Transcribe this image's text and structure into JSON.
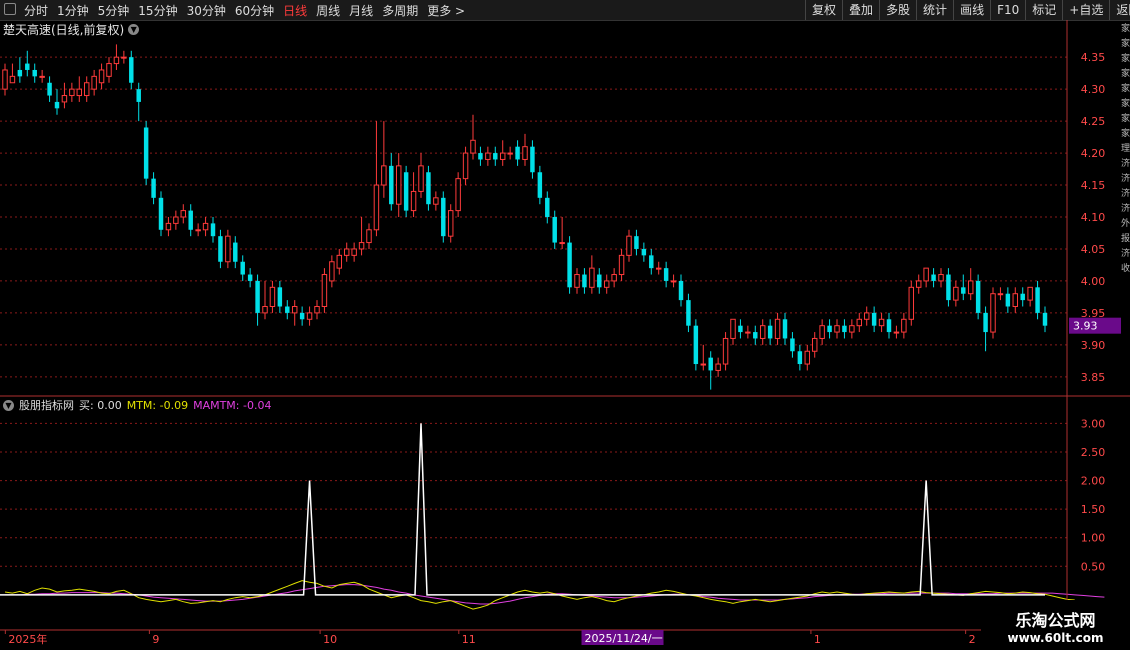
{
  "toolbar": {
    "periods": [
      "分时",
      "1分钟",
      "5分钟",
      "15分钟",
      "30分钟",
      "60分钟",
      "日线",
      "周线",
      "月线",
      "多周期",
      "更多 >"
    ],
    "active": "日线",
    "right_buttons": [
      "复权",
      "叠加",
      "多股",
      "统计",
      "画线",
      "F10",
      "标记",
      "+自选",
      "返回"
    ]
  },
  "chart": {
    "title": "楚天高速(日线,前复权)",
    "price_axis": [
      "4.35",
      "4.30",
      "4.25",
      "4.20",
      "4.15",
      "4.10",
      "4.05",
      "4.00",
      "3.95",
      "3.90",
      "3.85"
    ],
    "current_price": "3.93",
    "indicator_name": "股朋指标网",
    "ind_buy": "买: 0.00",
    "ind_mtm": "MTM: -0.09",
    "ind_mamtm": "MAMTM: -0.04",
    "ind_axis": [
      "3.00",
      "2.50",
      "2.00",
      "1.50",
      "1.00",
      "0.50"
    ],
    "date_labels": [
      "2025年",
      "9",
      "10",
      "11",
      "2025/11/24/一",
      "1",
      "2"
    ]
  },
  "right_strip": [
    "家",
    "家",
    "家",
    "家",
    "家",
    "家",
    "家",
    "家",
    "理",
    "济",
    "济",
    "济",
    "济",
    "外",
    "报",
    "济",
    "收"
  ],
  "watermark": {
    "line1": "乐淘公式网",
    "line2": "www.60lt.com"
  },
  "colors": {
    "up": "#ff3b3b",
    "down": "#00e0e8",
    "mtm": "#e0e000",
    "mamtm": "#e040e0",
    "buy": "#ffffff",
    "grid": "#8a1a1a",
    "axis": "#b03030",
    "highlight": "#6a0a8a"
  },
  "chart_data": {
    "type": "candlestick",
    "ylim": [
      3.82,
      4.38
    ],
    "candles": [
      [
        4.3,
        4.33,
        4.29,
        4.34
      ],
      [
        4.31,
        4.32,
        4.31,
        4.34
      ],
      [
        4.33,
        4.32,
        4.31,
        4.35
      ],
      [
        4.34,
        4.33,
        4.32,
        4.36
      ],
      [
        4.33,
        4.32,
        4.31,
        4.34
      ],
      [
        4.32,
        4.32,
        4.31,
        4.33
      ],
      [
        4.31,
        4.29,
        4.28,
        4.32
      ],
      [
        4.28,
        4.27,
        4.26,
        4.3
      ],
      [
        4.28,
        4.29,
        4.27,
        4.31
      ],
      [
        4.29,
        4.3,
        4.28,
        4.31
      ],
      [
        4.29,
        4.3,
        4.28,
        4.32
      ],
      [
        4.29,
        4.31,
        4.28,
        4.32
      ],
      [
        4.3,
        4.32,
        4.29,
        4.33
      ],
      [
        4.31,
        4.33,
        4.3,
        4.34
      ],
      [
        4.32,
        4.34,
        4.31,
        4.35
      ],
      [
        4.34,
        4.35,
        4.33,
        4.37
      ],
      [
        4.35,
        4.35,
        4.34,
        4.36
      ],
      [
        4.35,
        4.31,
        4.3,
        4.36
      ],
      [
        4.3,
        4.28,
        4.25,
        4.31
      ],
      [
        4.24,
        4.16,
        4.15,
        4.25
      ],
      [
        4.16,
        4.13,
        4.12,
        4.17
      ],
      [
        4.13,
        4.08,
        4.07,
        4.14
      ],
      [
        4.08,
        4.09,
        4.07,
        4.1
      ],
      [
        4.09,
        4.1,
        4.08,
        4.11
      ],
      [
        4.1,
        4.11,
        4.09,
        4.12
      ],
      [
        4.11,
        4.08,
        4.07,
        4.12
      ],
      [
        4.08,
        4.08,
        4.07,
        4.09
      ],
      [
        4.08,
        4.09,
        4.07,
        4.1
      ],
      [
        4.09,
        4.07,
        4.06,
        4.1
      ],
      [
        4.07,
        4.03,
        4.02,
        4.08
      ],
      [
        4.03,
        4.07,
        4.02,
        4.08
      ],
      [
        4.06,
        4.03,
        4.02,
        4.07
      ],
      [
        4.03,
        4.01,
        4.0,
        4.04
      ],
      [
        4.01,
        4.0,
        3.99,
        4.02
      ],
      [
        4.0,
        3.95,
        3.93,
        4.01
      ],
      [
        3.95,
        3.96,
        3.94,
        4.0
      ],
      [
        3.96,
        3.99,
        3.95,
        4.0
      ],
      [
        3.99,
        3.96,
        3.95,
        4.0
      ],
      [
        3.96,
        3.95,
        3.94,
        3.97
      ],
      [
        3.95,
        3.96,
        3.93,
        3.97
      ],
      [
        3.95,
        3.94,
        3.93,
        3.96
      ],
      [
        3.94,
        3.95,
        3.93,
        3.96
      ],
      [
        3.95,
        3.96,
        3.94,
        3.97
      ],
      [
        3.96,
        4.01,
        3.95,
        4.02
      ],
      [
        4.0,
        4.03,
        3.99,
        4.04
      ],
      [
        4.02,
        4.04,
        4.01,
        4.05
      ],
      [
        4.04,
        4.05,
        4.03,
        4.06
      ],
      [
        4.04,
        4.05,
        4.03,
        4.06
      ],
      [
        4.05,
        4.06,
        4.04,
        4.1
      ],
      [
        4.06,
        4.08,
        4.05,
        4.09
      ],
      [
        4.08,
        4.15,
        4.07,
        4.25
      ],
      [
        4.15,
        4.18,
        4.13,
        4.25
      ],
      [
        4.18,
        4.12,
        4.11,
        4.2
      ],
      [
        4.12,
        4.18,
        4.1,
        4.2
      ],
      [
        4.17,
        4.11,
        4.1,
        4.18
      ],
      [
        4.11,
        4.14,
        4.1,
        4.17
      ],
      [
        4.14,
        4.18,
        4.13,
        4.2
      ],
      [
        4.17,
        4.12,
        4.11,
        4.18
      ],
      [
        4.12,
        4.13,
        4.11,
        4.14
      ],
      [
        4.13,
        4.07,
        4.06,
        4.14
      ],
      [
        4.07,
        4.11,
        4.06,
        4.12
      ],
      [
        4.11,
        4.16,
        4.1,
        4.17
      ],
      [
        4.16,
        4.2,
        4.15,
        4.21
      ],
      [
        4.2,
        4.22,
        4.19,
        4.26
      ],
      [
        4.2,
        4.19,
        4.18,
        4.21
      ],
      [
        4.19,
        4.2,
        4.18,
        4.21
      ],
      [
        4.2,
        4.19,
        4.18,
        4.21
      ],
      [
        4.19,
        4.2,
        4.18,
        4.22
      ],
      [
        4.2,
        4.2,
        4.19,
        4.21
      ],
      [
        4.21,
        4.19,
        4.18,
        4.22
      ],
      [
        4.19,
        4.21,
        4.18,
        4.23
      ],
      [
        4.21,
        4.17,
        4.16,
        4.22
      ],
      [
        4.17,
        4.13,
        4.12,
        4.18
      ],
      [
        4.13,
        4.1,
        4.09,
        4.14
      ],
      [
        4.1,
        4.06,
        4.05,
        4.11
      ],
      [
        4.06,
        4.06,
        4.05,
        4.1
      ],
      [
        4.06,
        3.99,
        3.98,
        4.07
      ],
      [
        3.99,
        4.01,
        3.98,
        4.02
      ],
      [
        4.01,
        3.99,
        3.98,
        4.02
      ],
      [
        3.99,
        4.02,
        3.98,
        4.04
      ],
      [
        4.01,
        3.99,
        3.98,
        4.02
      ],
      [
        3.99,
        4.0,
        3.98,
        4.01
      ],
      [
        4.0,
        4.01,
        3.99,
        4.02
      ],
      [
        4.01,
        4.04,
        4.0,
        4.05
      ],
      [
        4.04,
        4.07,
        4.03,
        4.08
      ],
      [
        4.07,
        4.05,
        4.04,
        4.08
      ],
      [
        4.05,
        4.04,
        4.03,
        4.06
      ],
      [
        4.04,
        4.02,
        4.01,
        4.05
      ],
      [
        4.02,
        4.02,
        4.01,
        4.03
      ],
      [
        4.02,
        4.0,
        3.99,
        4.03
      ],
      [
        4.0,
        4.0,
        3.99,
        4.01
      ],
      [
        4.0,
        3.97,
        3.96,
        4.01
      ],
      [
        3.97,
        3.93,
        3.92,
        3.98
      ],
      [
        3.93,
        3.87,
        3.86,
        3.94
      ],
      [
        3.87,
        3.87,
        3.86,
        3.9
      ],
      [
        3.88,
        3.86,
        3.83,
        3.89
      ],
      [
        3.86,
        3.87,
        3.85,
        3.88
      ],
      [
        3.87,
        3.91,
        3.86,
        3.92
      ],
      [
        3.91,
        3.94,
        3.9,
        3.94
      ],
      [
        3.93,
        3.92,
        3.91,
        3.94
      ],
      [
        3.92,
        3.92,
        3.91,
        3.93
      ],
      [
        3.92,
        3.91,
        3.9,
        3.93
      ],
      [
        3.91,
        3.93,
        3.9,
        3.94
      ],
      [
        3.93,
        3.91,
        3.9,
        3.94
      ],
      [
        3.91,
        3.94,
        3.9,
        3.95
      ],
      [
        3.94,
        3.91,
        3.9,
        3.95
      ],
      [
        3.91,
        3.89,
        3.88,
        3.92
      ],
      [
        3.89,
        3.87,
        3.86,
        3.9
      ],
      [
        3.87,
        3.89,
        3.86,
        3.9
      ],
      [
        3.89,
        3.91,
        3.88,
        3.92
      ],
      [
        3.91,
        3.93,
        3.9,
        3.94
      ],
      [
        3.93,
        3.92,
        3.91,
        3.94
      ],
      [
        3.92,
        3.93,
        3.91,
        3.94
      ],
      [
        3.93,
        3.92,
        3.91,
        3.94
      ],
      [
        3.92,
        3.93,
        3.91,
        3.94
      ],
      [
        3.93,
        3.94,
        3.92,
        3.95
      ],
      [
        3.94,
        3.95,
        3.93,
        3.96
      ],
      [
        3.95,
        3.93,
        3.92,
        3.96
      ],
      [
        3.93,
        3.94,
        3.92,
        3.95
      ],
      [
        3.94,
        3.92,
        3.91,
        3.95
      ],
      [
        3.92,
        3.92,
        3.91,
        3.93
      ],
      [
        3.92,
        3.94,
        3.91,
        3.95
      ],
      [
        3.94,
        3.99,
        3.93,
        4.0
      ],
      [
        3.99,
        4.0,
        3.98,
        4.01
      ],
      [
        4.0,
        4.02,
        3.99,
        4.02
      ],
      [
        4.01,
        4.0,
        3.99,
        4.02
      ],
      [
        4.0,
        4.01,
        3.99,
        4.02
      ],
      [
        4.01,
        3.97,
        3.96,
        4.02
      ],
      [
        3.97,
        3.99,
        3.96,
        4.0
      ],
      [
        3.99,
        3.98,
        3.97,
        4.01
      ],
      [
        3.98,
        4.0,
        3.97,
        4.02
      ],
      [
        4.0,
        3.95,
        3.94,
        4.01
      ],
      [
        3.95,
        3.92,
        3.89,
        3.96
      ],
      [
        3.92,
        3.98,
        3.91,
        3.99
      ],
      [
        3.98,
        3.98,
        3.97,
        3.99
      ],
      [
        3.98,
        3.96,
        3.95,
        3.99
      ],
      [
        3.96,
        3.98,
        3.95,
        3.99
      ],
      [
        3.98,
        3.97,
        3.96,
        3.99
      ],
      [
        3.97,
        3.99,
        3.96,
        3.99
      ],
      [
        3.99,
        3.95,
        3.94,
        4.0
      ],
      [
        3.95,
        3.93,
        3.92,
        3.96
      ]
    ],
    "buy_signals": [
      {
        "index": 41,
        "value": 2.0
      },
      {
        "index": 56,
        "value": 3.0
      },
      {
        "index": 124,
        "value": 2.0
      }
    ],
    "mtm": [
      0.05,
      0.03,
      0.06,
      0.02,
      0.08,
      0.12,
      0.1,
      0.05,
      0.07,
      0.08,
      0.1,
      0.08,
      0.06,
      0.03,
      0.02,
      0.06,
      0.08,
      0.02,
      -0.05,
      -0.08,
      -0.1,
      -0.12,
      -0.1,
      -0.08,
      -0.12,
      -0.15,
      -0.14,
      -0.12,
      -0.1,
      -0.12,
      -0.08,
      -0.05,
      -0.03,
      -0.05,
      -0.03,
      0.0,
      0.05,
      0.1,
      0.15,
      0.2,
      0.25,
      0.22,
      0.2,
      0.15,
      0.12,
      0.18,
      0.2,
      0.22,
      0.18,
      0.1,
      0.05,
      0.0,
      -0.05,
      -0.02,
      0.0,
      -0.05,
      -0.1,
      -0.12,
      -0.15,
      -0.12,
      -0.1,
      -0.15,
      -0.2,
      -0.25,
      -0.22,
      -0.18,
      -0.1,
      -0.05,
      0.0,
      0.05,
      0.08,
      0.05,
      0.03,
      0.05,
      0.02,
      -0.02,
      -0.05,
      -0.08,
      -0.05,
      -0.03,
      -0.06,
      -0.1,
      -0.12,
      -0.08,
      -0.05,
      -0.02,
      0.0,
      0.03,
      0.05,
      0.08,
      0.06,
      0.03,
      0.0,
      -0.02,
      -0.05,
      -0.08,
      -0.1,
      -0.12,
      -0.15,
      -0.12,
      -0.1,
      -0.08,
      -0.1,
      -0.12,
      -0.1,
      -0.08,
      -0.06,
      -0.04,
      -0.02,
      0.02,
      0.05,
      0.03,
      0.05,
      0.03,
      0.01,
      0.0,
      0.02,
      0.03,
      0.04,
      0.05,
      0.04,
      0.03,
      0.05,
      0.06,
      0.04,
      0.03,
      0.02,
      0.01,
      0.0,
      -0.01,
      0.02,
      0.04,
      0.06,
      0.05,
      0.04,
      0.02,
      0.03,
      0.05,
      0.04,
      0.02,
      0.01,
      -0.02,
      -0.05,
      -0.08,
      -0.09
    ],
    "mamtm": [
      0.0,
      0.0,
      0.0,
      0.01,
      0.01,
      0.02,
      0.02,
      0.03,
      0.03,
      0.04,
      0.04,
      0.04,
      0.04,
      0.04,
      0.03,
      0.03,
      0.02,
      0.01,
      0.0,
      -0.02,
      -0.04,
      -0.05,
      -0.06,
      -0.07,
      -0.08,
      -0.09,
      -0.1,
      -0.11,
      -0.11,
      -0.11,
      -0.1,
      -0.09,
      -0.08,
      -0.06,
      -0.04,
      -0.02,
      0.0,
      0.02,
      0.04,
      0.07,
      0.09,
      0.11,
      0.13,
      0.15,
      0.16,
      0.17,
      0.18,
      0.18,
      0.17,
      0.15,
      0.13,
      0.1,
      0.08,
      0.05,
      0.03,
      0.0,
      -0.02,
      -0.04,
      -0.06,
      -0.08,
      -0.1,
      -0.12,
      -0.14,
      -0.15,
      -0.16,
      -0.16,
      -0.15,
      -0.13,
      -0.11,
      -0.08,
      -0.05,
      -0.03,
      -0.01,
      0.01,
      0.02,
      0.02,
      0.01,
      0.0,
      -0.01,
      -0.02,
      -0.03,
      -0.04,
      -0.05,
      -0.05,
      -0.05,
      -0.04,
      -0.03,
      -0.02,
      -0.01,
      0.0,
      0.01,
      0.01,
      0.0,
      -0.01,
      -0.03,
      -0.04,
      -0.06,
      -0.07,
      -0.08,
      -0.09,
      -0.09,
      -0.09,
      -0.09,
      -0.09,
      -0.09,
      -0.08,
      -0.07,
      -0.06,
      -0.05,
      -0.03,
      -0.02,
      -0.01,
      0.0,
      0.01,
      0.01,
      0.01,
      0.02,
      0.02,
      0.02,
      0.03,
      0.03,
      0.03,
      0.03,
      0.03,
      0.03,
      0.03,
      0.03,
      0.03,
      0.02,
      0.02,
      0.02,
      0.02,
      0.02,
      0.02,
      0.03,
      0.03,
      0.03,
      0.03,
      0.03,
      0.03,
      0.03,
      0.03,
      0.02,
      0.01,
      0.0,
      -0.01,
      -0.02,
      -0.03,
      -0.04
    ]
  }
}
